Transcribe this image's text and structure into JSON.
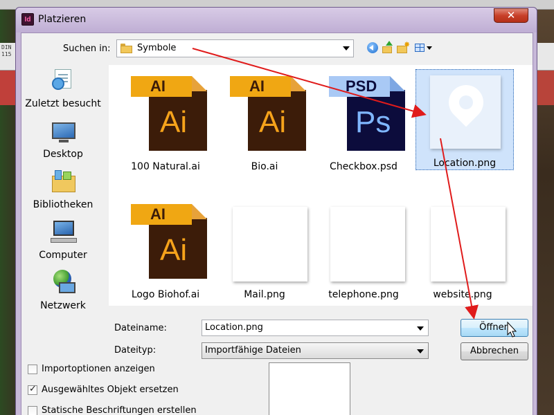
{
  "dialog": {
    "title": "Platzieren",
    "app_icon_text": "Id",
    "close_label": "✕"
  },
  "background": {
    "ruler_text": "DIN 115"
  },
  "look_in": {
    "label": "Suchen in:",
    "value": "Symbole"
  },
  "toolbar": {
    "icons": [
      "back-icon",
      "up-folder-icon",
      "new-folder-icon",
      "views-menu-icon"
    ]
  },
  "places": [
    {
      "label": "Zuletzt besucht",
      "icon": "recent-places-icon"
    },
    {
      "label": "Desktop",
      "icon": "desktop-icon"
    },
    {
      "label": "Bibliotheken",
      "icon": "libraries-icon"
    },
    {
      "label": "Computer",
      "icon": "computer-icon"
    },
    {
      "label": "Netzwerk",
      "icon": "network-icon"
    }
  ],
  "files": [
    {
      "name": "100 Natural.ai",
      "type": "ai",
      "badge": "AI",
      "glyph": "Ai"
    },
    {
      "name": "Bio.ai",
      "type": "ai",
      "badge": "AI",
      "glyph": "Ai"
    },
    {
      "name": "Checkbox.psd",
      "type": "psd",
      "badge": "PSD",
      "glyph": "Ps"
    },
    {
      "name": "Location.png",
      "type": "png-location",
      "selected": true
    },
    {
      "name": "Logo Biohof.ai",
      "type": "ai",
      "badge": "AI",
      "glyph": "Ai"
    },
    {
      "name": "Mail.png",
      "type": "png-blank"
    },
    {
      "name": "telephone.png",
      "type": "png-blank"
    },
    {
      "name": "website.png",
      "type": "png-blank"
    }
  ],
  "filename": {
    "label": "Dateiname:",
    "value": "Location.png"
  },
  "filetype": {
    "label": "Dateityp:",
    "value": "Importfähige Dateien"
  },
  "buttons": {
    "open": "Öffnen",
    "cancel": "Abbrechen"
  },
  "options": [
    {
      "label": "Importoptionen anzeigen",
      "checked": false
    },
    {
      "label": "Ausgewähltes Objekt ersetzen",
      "checked": true
    },
    {
      "label": "Statische Beschriftungen erstellen",
      "checked": false
    }
  ],
  "colors": {
    "annotation_arrow": "#e01b1b",
    "ai_badge": "#f0a713",
    "ai_body": "#3c1c09",
    "psd_body": "#0c0c3c",
    "selection": "#cfe3fb"
  }
}
